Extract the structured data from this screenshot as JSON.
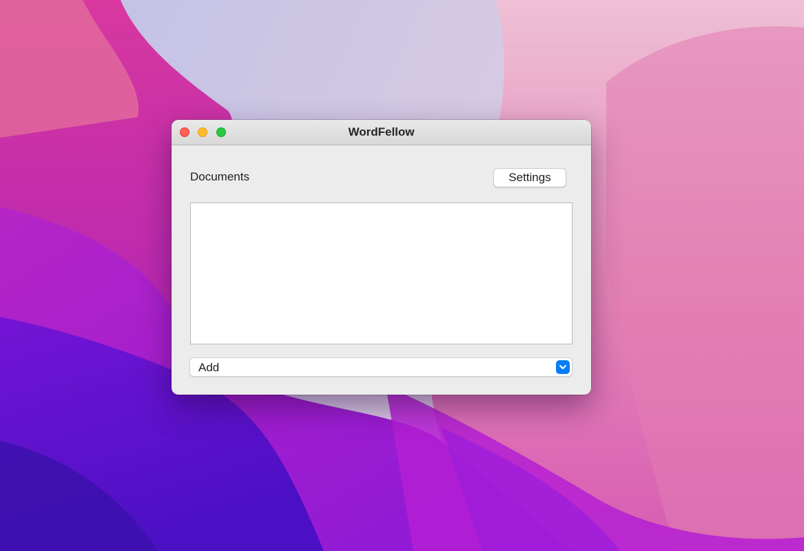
{
  "desktop": {
    "wallpaper": "purple-pink-abstract",
    "colors": {
      "violet": "#5c0fd0",
      "magenta": "#c52ca8",
      "pink": "#e46aa8",
      "sky": "#c9c6e4"
    }
  },
  "window": {
    "title": "WordFellow",
    "traffic_lights": {
      "close_color": "#fe5f57",
      "minimize_color": "#febc2e",
      "zoom_color": "#28c840"
    }
  },
  "main": {
    "documents_label": "Documents",
    "settings_label": "Settings",
    "documents": [],
    "add_select": {
      "selected": "Add",
      "accent_color": "#0a7cf5",
      "icon": "chevron-down-icon"
    }
  }
}
